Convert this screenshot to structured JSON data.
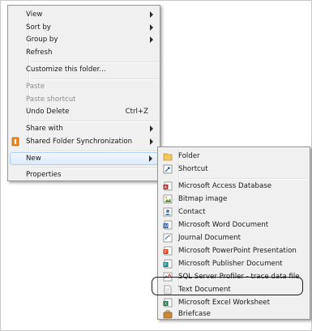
{
  "context_menu": {
    "items": [
      {
        "label": "View"
      },
      {
        "label": "Sort by"
      },
      {
        "label": "Group by"
      },
      {
        "label": "Refresh"
      },
      {
        "label": "Customize this folder..."
      },
      {
        "label": "Paste"
      },
      {
        "label": "Paste shortcut"
      },
      {
        "label": "Undo Delete",
        "shortcut": "Ctrl+Z"
      },
      {
        "label": "Share with"
      },
      {
        "label": "Shared Folder Synchronization"
      },
      {
        "label": "New"
      },
      {
        "label": "Properties"
      }
    ]
  },
  "new_submenu": {
    "items": [
      {
        "label": "Folder",
        "icon": "folder-icon"
      },
      {
        "label": "Shortcut",
        "icon": "shortcut-icon"
      },
      {
        "label": "Microsoft Access Database",
        "icon": "access-icon"
      },
      {
        "label": "Bitmap image",
        "icon": "bitmap-icon"
      },
      {
        "label": "Contact",
        "icon": "contact-icon"
      },
      {
        "label": "Microsoft Word Document",
        "icon": "word-icon"
      },
      {
        "label": "Journal Document",
        "icon": "journal-icon"
      },
      {
        "label": "Microsoft PowerPoint Presentation",
        "icon": "powerpoint-icon"
      },
      {
        "label": "Microsoft Publisher Document",
        "icon": "publisher-icon"
      },
      {
        "label": "SQL Server Profiler - trace data file",
        "icon": "sql-profiler-icon"
      },
      {
        "label": "Text Document",
        "icon": "text-document-icon"
      },
      {
        "label": "Microsoft Excel Worksheet",
        "icon": "excel-icon"
      },
      {
        "label": "Briefcase",
        "icon": "briefcase-icon"
      }
    ]
  },
  "colors": {
    "menu_bg": "#f0f0f0",
    "highlight": "#dceaf9",
    "disabled_text": "#8d8d8d"
  }
}
